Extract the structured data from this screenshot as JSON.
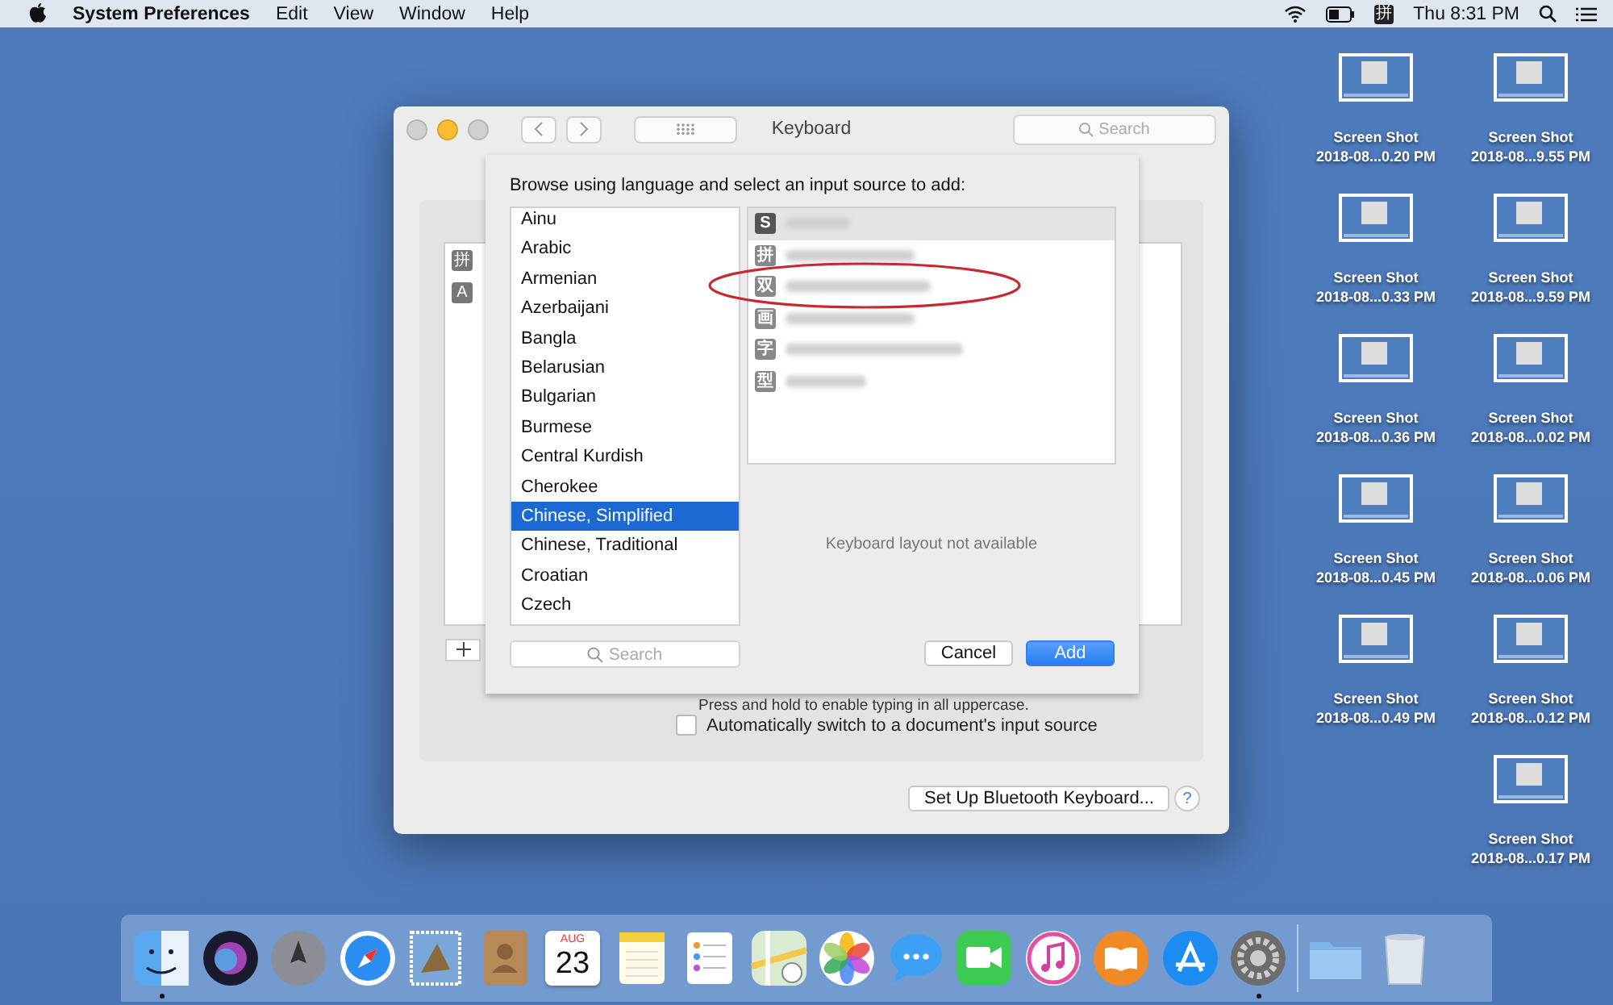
{
  "menu_bar": {
    "app_name": "System Preferences",
    "items": [
      "Edit",
      "View",
      "Window",
      "Help"
    ],
    "input_badge": "拼",
    "clock": "Thu 8:31 PM"
  },
  "desktop_files": [
    {
      "name": "Screen Shot",
      "date": "2018-08...0.20 PM"
    },
    {
      "name": "Screen Shot",
      "date": "2018-08...9.55 PM"
    },
    {
      "name": "Screen Shot",
      "date": "2018-08...0.33 PM"
    },
    {
      "name": "Screen Shot",
      "date": "2018-08...9.59 PM"
    },
    {
      "name": "Screen Shot",
      "date": "2018-08...0.36 PM"
    },
    {
      "name": "Screen Shot",
      "date": "2018-08...0.02 PM"
    },
    {
      "name": "Screen Shot",
      "date": "2018-08...0.45 PM"
    },
    {
      "name": "Screen Shot",
      "date": "2018-08...0.06 PM"
    },
    {
      "name": "Screen Shot",
      "date": "2018-08...0.49 PM"
    },
    {
      "name": "Screen Shot",
      "date": "2018-08...0.12 PM"
    },
    {
      "name": "Screen Shot",
      "date": "2018-08...0.17 PM"
    }
  ],
  "window": {
    "title": "Keyboard",
    "search_placeholder": "Search",
    "sources": [
      {
        "icon": "拼"
      },
      {
        "icon": "A"
      }
    ],
    "hint": "Press and hold to enable typing in all uppercase.",
    "auto_switch": {
      "label": "Automatically switch to a document's input source",
      "checked": false
    },
    "bluetooth_button": "Set Up Bluetooth Keyboard...",
    "help": "?"
  },
  "sheet": {
    "prompt": "Browse using language and select an input source to add:",
    "languages": [
      {
        "label": "Ainu",
        "selected": false
      },
      {
        "label": "Arabic",
        "selected": false
      },
      {
        "label": "Armenian",
        "selected": false
      },
      {
        "label": "Azerbaijani",
        "selected": false
      },
      {
        "label": "Bangla",
        "selected": false
      },
      {
        "label": "Belarusian",
        "selected": false
      },
      {
        "label": "Bulgarian",
        "selected": false
      },
      {
        "label": "Burmese",
        "selected": false
      },
      {
        "label": "Central Kurdish",
        "selected": false
      },
      {
        "label": "Cherokee",
        "selected": false
      },
      {
        "label": "Chinese, Simplified",
        "selected": true
      },
      {
        "label": "Chinese, Traditional",
        "selected": false
      },
      {
        "label": "Croatian",
        "selected": false
      },
      {
        "label": "Czech",
        "selected": false
      }
    ],
    "sources": [
      {
        "icon": "S",
        "selected": true
      },
      {
        "icon": "拼",
        "selected": false
      },
      {
        "icon": "双",
        "selected": false
      },
      {
        "icon": "画",
        "selected": false
      },
      {
        "icon": "字",
        "selected": false
      },
      {
        "icon": "型",
        "selected": false
      }
    ],
    "layout_message": "Keyboard layout not available",
    "search_placeholder": "Search",
    "buttons": [
      {
        "label": "Cancel",
        "kind": "secondary"
      },
      {
        "label": "Add",
        "kind": "primary"
      }
    ]
  },
  "dock": [
    {
      "kind": "finder",
      "running": true
    },
    {
      "kind": "siri",
      "running": false
    },
    {
      "kind": "launchpad",
      "running": false
    },
    {
      "kind": "safari",
      "running": false
    },
    {
      "kind": "mail",
      "running": false
    },
    {
      "kind": "contacts",
      "running": false
    },
    {
      "kind": "calendar",
      "running": false,
      "month": "AUG",
      "day": "23"
    },
    {
      "kind": "notes",
      "running": false
    },
    {
      "kind": "reminders",
      "running": false
    },
    {
      "kind": "maps",
      "running": false
    },
    {
      "kind": "photos",
      "running": false
    },
    {
      "kind": "messages",
      "running": false
    },
    {
      "kind": "facetime",
      "running": false
    },
    {
      "kind": "music",
      "running": false
    },
    {
      "kind": "books",
      "running": false
    },
    {
      "kind": "appstore",
      "running": false
    },
    {
      "kind": "preferences",
      "running": true
    },
    {
      "kind": "divider"
    },
    {
      "kind": "folder",
      "running": false
    },
    {
      "kind": "trash",
      "running": false
    }
  ]
}
